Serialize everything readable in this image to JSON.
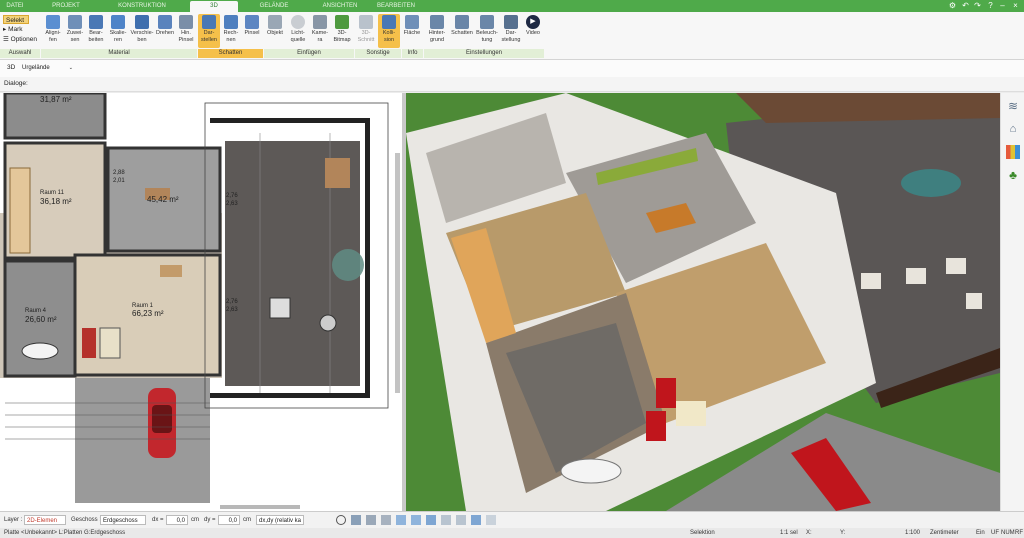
{
  "menu": {
    "tabs": [
      "DATEI",
      "PROJEKT",
      "KONSTRUKTION",
      "3D",
      "GELÄNDE",
      "ANSICHTEN",
      "BEARBEITEN"
    ],
    "active_tab": "3D"
  },
  "ribbon": {
    "selection": {
      "options": [
        "Selekt",
        "Mark",
        "Optionen"
      ]
    },
    "buttons": {
      "align": "Aligni-\nfen",
      "group": "Zuwei-\nsen",
      "edit": "Bear-\nbeiten",
      "scale": "Skalie-\nren",
      "move": "Verschie-\nben",
      "rotate": "Drehen",
      "add_brush": "Hin.\nPinsel",
      "display": "Dar-\nstellen",
      "compute": "Rech-\nnen",
      "brush": "Pinsel",
      "object": "Objekt",
      "light": "Licht-\nquelle",
      "camera": "Kame-\nra",
      "bitmap": "3D-\nBitmap",
      "section": "3D-\nSchnitt",
      "collision": "Kolli-\nsion",
      "area": "Fläche",
      "background": "Hinter-\ngrund",
      "shadows": "Schatten",
      "lighting": "Beleuch-\ntung",
      "rendering": "Dar-\nstellung",
      "video": "Video"
    },
    "groups": [
      "Auswahl",
      "Material",
      "Schatten",
      "Einfügen",
      "Sonstige",
      "Info",
      "Einstellungen"
    ]
  },
  "toolbar": {
    "view_label": "3D",
    "view_select": "Urgelände"
  },
  "dialog_label": "Dialoge:",
  "plan": {
    "rooms": [
      {
        "name": "",
        "area": "31,87 m²"
      },
      {
        "name": "Raum 11",
        "area": "36,18 m²"
      },
      {
        "name": "",
        "area": "45,42 m²"
      },
      {
        "name": "Raum 1",
        "area": "66,23 m²"
      },
      {
        "name": "Raum 4",
        "area": "26,60 m²"
      }
    ],
    "dims": [
      "2,88",
      "2,01",
      "2,76",
      "2,63",
      "2,76",
      "2,63"
    ]
  },
  "statusbar": {
    "layer_label": "Layer :",
    "layer_value": "2D-Elemen",
    "floor_label": "Geschoss :",
    "floor_value": "Erdgeschoss",
    "dx_label": "dx =",
    "dx_value": "0,0",
    "dy_label": "dy =",
    "dy_value": "0,0",
    "unit": "cm",
    "mode_value": "dx,dy (relativ ka",
    "info": "Platte <Unbekannt> L:Platten G:Erdgeschoss",
    "selection": "Selektion",
    "scale": "1:1 sel",
    "x_label": "X:",
    "y_label": "Y:",
    "zoom": "1:100",
    "units": "Zentimeter",
    "ein": "Ein",
    "uf": "UF",
    "num": "NUM",
    "rf": "RF"
  },
  "colors": {
    "menu_green": "#4faa4a",
    "accent_orange": "#f5c04a",
    "lawn": "#4d8a36",
    "deck": "#5a5655"
  }
}
